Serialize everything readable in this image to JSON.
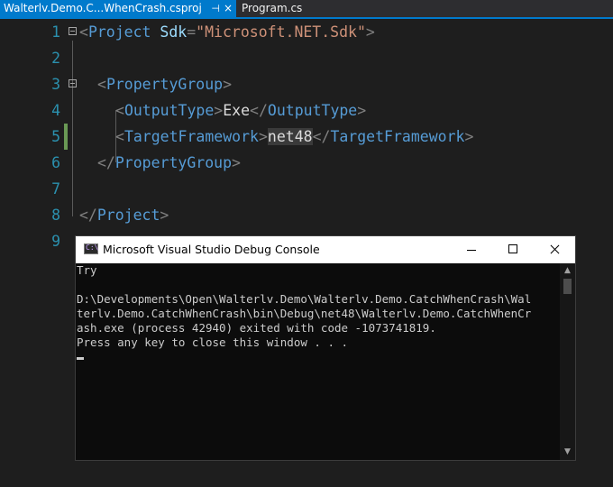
{
  "tabs": {
    "active": {
      "label": "Walterlv.Demo.C...WhenCrash.csproj",
      "pin": "⊣",
      "close": "×"
    },
    "inactive": {
      "label": "Program.cs"
    }
  },
  "editor": {
    "lines": [
      {
        "number": "1",
        "segments": [
          [
            "b",
            "<"
          ],
          [
            "e",
            "Project"
          ],
          [
            "t",
            " "
          ],
          [
            "a",
            "Sdk"
          ],
          [
            "b",
            "="
          ],
          [
            "s",
            "\"Microsoft.NET.Sdk\""
          ],
          [
            "b",
            ">"
          ]
        ]
      },
      {
        "number": "2",
        "segments": []
      },
      {
        "number": "3",
        "segments": [
          [
            "b",
            "<"
          ],
          [
            "e",
            "PropertyGroup"
          ],
          [
            "b",
            ">"
          ]
        ]
      },
      {
        "number": "4",
        "segments": [
          [
            "b",
            "<"
          ],
          [
            "e",
            "OutputType"
          ],
          [
            "b",
            ">"
          ],
          [
            "t",
            "Exe"
          ],
          [
            "b",
            "</"
          ],
          [
            "e",
            "OutputType"
          ],
          [
            "b",
            ">"
          ]
        ]
      },
      {
        "number": "5",
        "segments": [
          [
            "b",
            "<"
          ],
          [
            "e",
            "TargetFramework"
          ],
          [
            "b",
            ">"
          ],
          [
            "t",
            "net48"
          ],
          [
            "b",
            "</"
          ],
          [
            "e",
            "TargetFramework"
          ],
          [
            "b",
            ">"
          ]
        ]
      },
      {
        "number": "6",
        "segments": [
          [
            "b",
            "</"
          ],
          [
            "e",
            "PropertyGroup"
          ],
          [
            "b",
            ">"
          ]
        ]
      },
      {
        "number": "7",
        "segments": []
      },
      {
        "number": "8",
        "segments": [
          [
            "b",
            "</"
          ],
          [
            "e",
            "Project"
          ],
          [
            "b",
            ">"
          ]
        ]
      },
      {
        "number": "9",
        "segments": []
      }
    ]
  },
  "console": {
    "title": "Microsoft Visual Studio Debug Console",
    "icon_text": "C:\\",
    "lines": [
      "Try",
      "",
      "D:\\Developments\\Open\\Walterlv.Demo\\Walterlv.Demo.CatchWhenCrash\\Wal",
      "terlv.Demo.CatchWhenCrash\\bin\\Debug\\net48\\Walterlv.Demo.CatchWhenCr",
      "ash.exe (process 42940) exited with code -1073741819.",
      "Press any key to close this window . . ."
    ],
    "scroll_up": "▲",
    "scroll_down": "▼"
  },
  "colors": {
    "tab_active": "#007acc",
    "editor_bg": "#1e1e1e",
    "line_number": "#2b91af",
    "xml_element": "#569cd6",
    "xml_attribute": "#9cdcfe",
    "xml_string": "#ce9178",
    "xml_bracket": "#808080",
    "console_bg": "#0c0c0c",
    "console_text": "#cccccc"
  }
}
